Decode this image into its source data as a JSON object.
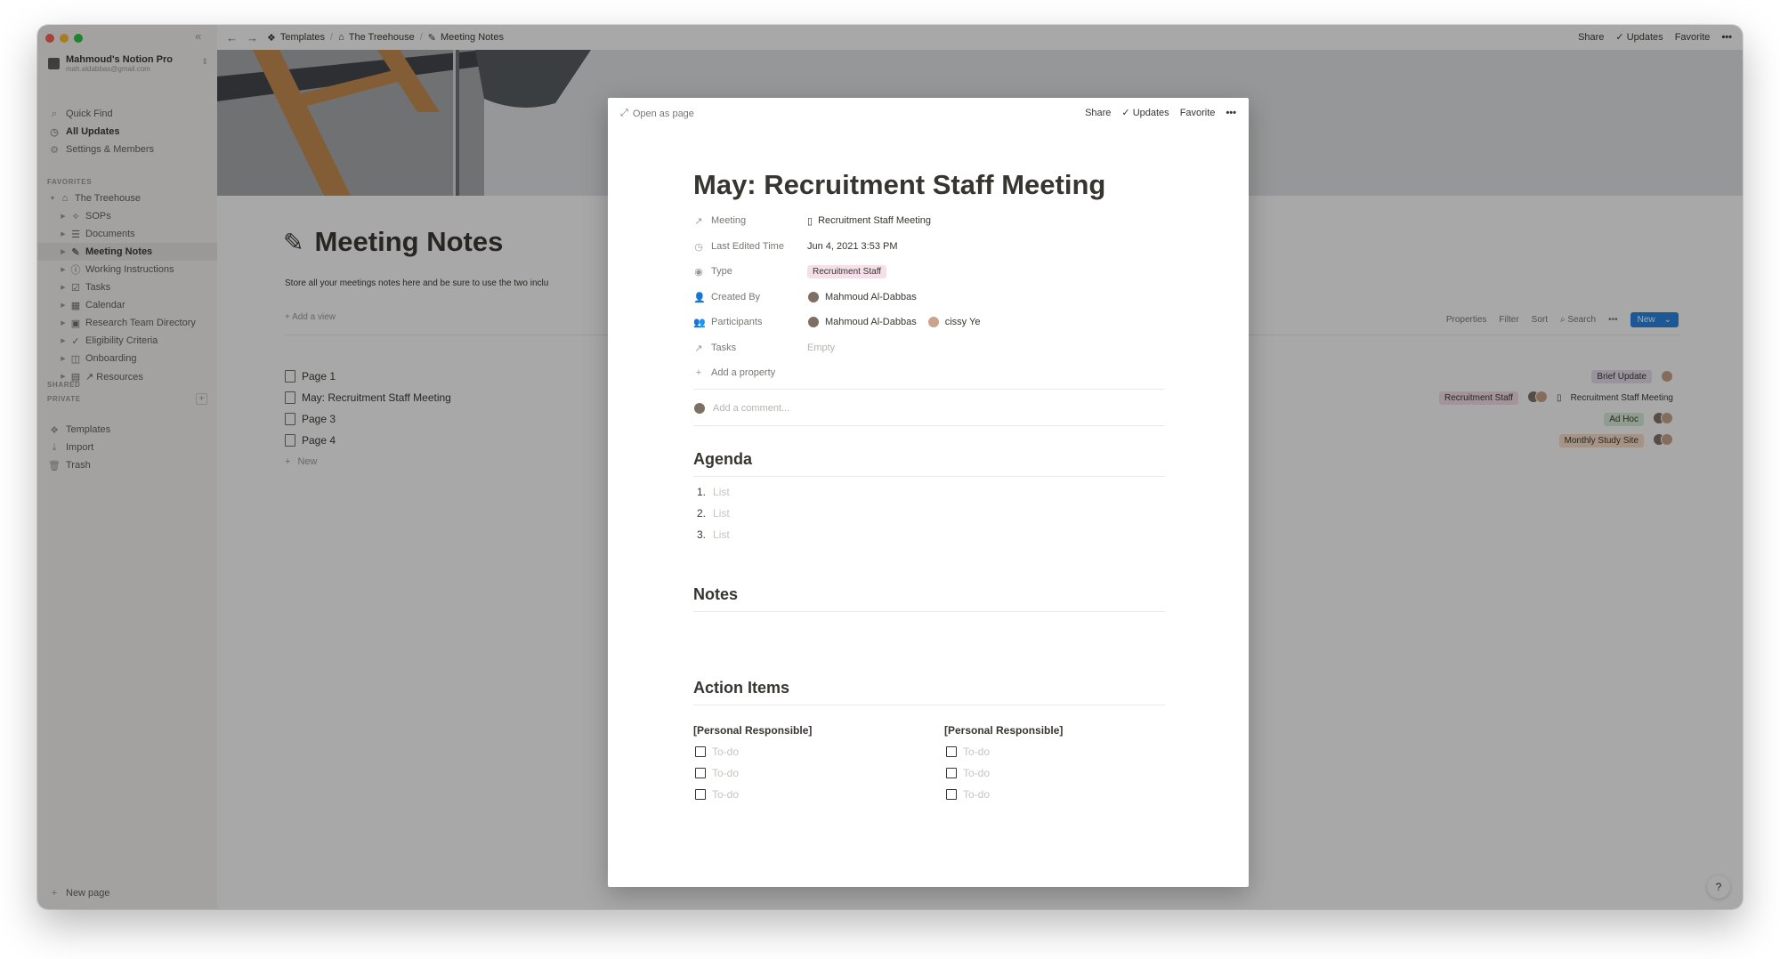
{
  "sidebar": {
    "workspace_name": "Mahmoud's Notion Pro",
    "workspace_email": "mah.aldabbas@gmail.com",
    "nav": [
      "Quick Find",
      "All Updates",
      "Settings & Members"
    ],
    "favorites_label": "FAVORITES",
    "tree": [
      "The Treehouse",
      "SOPs",
      "Documents",
      "Meeting Notes",
      "Working Instructions",
      "Tasks",
      "Calendar",
      "Research Team Directory",
      "Eligibility Criteria",
      "Onboarding",
      "↗ Resources"
    ],
    "shared_label": "SHARED",
    "private_label": "PRIVATE",
    "bottom": [
      "Templates",
      "Import",
      "Trash"
    ],
    "new_page": "New page"
  },
  "topbar": {
    "crumbs": [
      "Templates",
      "The Treehouse",
      "Meeting Notes"
    ],
    "actions": [
      "Share",
      "Updates",
      "Favorite"
    ]
  },
  "page": {
    "title": "Meeting Notes",
    "description": "Store all your meetings notes here and be sure to use the two inclu",
    "add_view": "Add a view",
    "tools": [
      "Properties",
      "Filter",
      "Sort",
      "Search"
    ],
    "new_button": "New",
    "rows": [
      "Page 1",
      "May: Recruitment Staff Meeting",
      "Page 3",
      "Page 4"
    ],
    "row_new": "New",
    "right_cells": {
      "r1_tag": "Brief Update",
      "r2_tag": "Recruitment Staff",
      "r2_link": "Recruitment Staff Meeting",
      "r3_tag": "Ad Hoc",
      "r4_tag": "Monthly Study Site"
    }
  },
  "modal": {
    "open_as_page": "Open as page",
    "actions": [
      "Share",
      "Updates",
      "Favorite"
    ],
    "title": "May: Recruitment Staff Meeting",
    "props": {
      "meeting_label": "Meeting",
      "meeting_value": "Recruitment Staff Meeting",
      "edited_label": "Last Edited Time",
      "edited_value": "Jun 4, 2021 3:53 PM",
      "type_label": "Type",
      "type_value": "Recruitment Staff",
      "created_label": "Created By",
      "created_value": "Mahmoud Al-Dabbas",
      "participants_label": "Participants",
      "participant_1": "Mahmoud Al-Dabbas",
      "participant_2": "cissy Ye",
      "tasks_label": "Tasks",
      "tasks_value": "Empty",
      "add_property": "Add a property"
    },
    "add_comment": "Add a comment...",
    "agenda_heading": "Agenda",
    "agenda_items": [
      "1.",
      "2.",
      "3."
    ],
    "list_placeholder": "List",
    "notes_heading": "Notes",
    "action_heading": "Action Items",
    "responsible": "[Personal Responsible]",
    "todo_placeholder": "To-do"
  },
  "colors": {
    "accent_blue": "#2383e2",
    "tag_pink": "#f5e0e9",
    "tag_purple": "#e8deee",
    "tag_green": "#dbeddb",
    "tag_orange": "#fadec9"
  }
}
